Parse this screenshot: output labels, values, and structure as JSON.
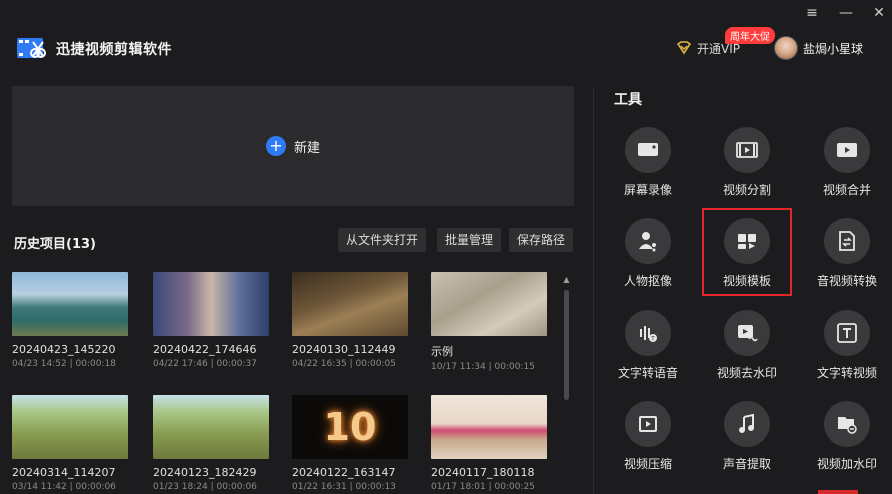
{
  "app": {
    "title": "迅捷视频剪辑软件",
    "vip_label": "开通VIP",
    "promo_badge": "周年大促",
    "username": "盐焗小星球",
    "window_controls": [
      "menu-icon",
      "minimize-icon",
      "close-icon"
    ]
  },
  "new_project": {
    "label": "新建",
    "icon": "plus-icon"
  },
  "history": {
    "title": "历史项目(13)",
    "buttons": [
      "从文件夹打开",
      "批量管理",
      "保存路径"
    ],
    "projects": [
      {
        "name": "20240423_145220",
        "meta": "04/23 14:52 | 00:00:18",
        "thumb": "lake"
      },
      {
        "name": "20240422_174646",
        "meta": "04/22 17:46 | 00:00:37",
        "thumb": "street"
      },
      {
        "name": "20240130_112449",
        "meta": "04/22 16:35 | 00:00:05",
        "thumb": "desert-car"
      },
      {
        "name": "示例",
        "meta": "10/17 11:34 | 00:00:15",
        "thumb": "sand"
      },
      {
        "name": "20240314_114207",
        "meta": "03/14 11:42 | 00:00:06",
        "thumb": "road-field"
      },
      {
        "name": "20240123_182429",
        "meta": "01/23 18:24 | 00:00:06",
        "thumb": "road-field"
      },
      {
        "name": "20240122_163147",
        "meta": "01/22 16:31 | 00:00:13",
        "thumb": "number-10"
      },
      {
        "name": "20240117_180118",
        "meta": "01/17 18:01 | 00:00:25",
        "thumb": "kids"
      }
    ],
    "thumb_text_number": "10"
  },
  "tools": {
    "title": "工具",
    "items": [
      {
        "label": "屏幕录像",
        "icon": "screen-record-icon"
      },
      {
        "label": "视频分割",
        "icon": "video-split-icon"
      },
      {
        "label": "视频合并",
        "icon": "video-merge-icon"
      },
      {
        "label": "人物抠像",
        "icon": "person-cutout-icon"
      },
      {
        "label": "视频模板",
        "icon": "video-template-icon"
      },
      {
        "label": "音视频转换",
        "icon": "av-convert-icon"
      },
      {
        "label": "文字转语音",
        "icon": "text-to-speech-icon"
      },
      {
        "label": "视频去水印",
        "icon": "remove-watermark-icon"
      },
      {
        "label": "文字转视频",
        "icon": "text-to-video-icon"
      },
      {
        "label": "视频压缩",
        "icon": "video-compress-icon"
      },
      {
        "label": "声音提取",
        "icon": "audio-extract-icon"
      },
      {
        "label": "视频加水印",
        "icon": "add-watermark-icon"
      }
    ],
    "highlighted": "视频模板"
  },
  "colors": {
    "accent": "#2f7bf5",
    "highlight": "#e3262b",
    "vip_gold": "#e0b640",
    "background": "#1c1c1e"
  }
}
